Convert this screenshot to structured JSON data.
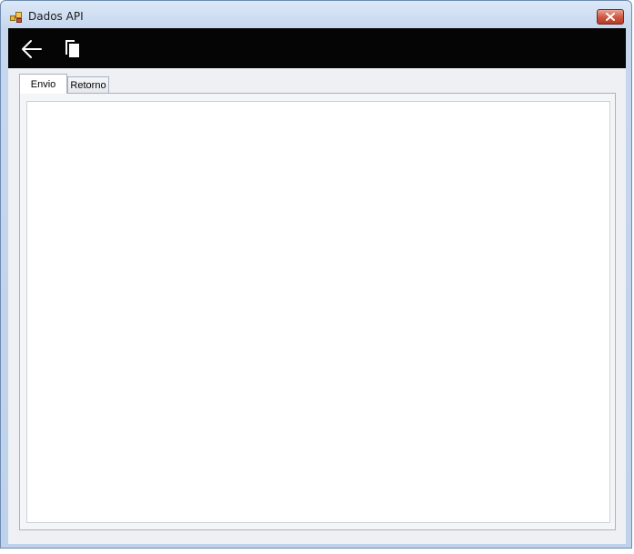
{
  "window": {
    "title": "Dados API",
    "icon": "app-window-icon",
    "close_icon": "close-icon"
  },
  "toolbar": {
    "back_icon": "back-arrow-icon",
    "copy_icon": "copy-icon"
  },
  "tabs": [
    {
      "label": "Envio",
      "selected": true
    },
    {
      "label": "Retorno",
      "selected": false
    }
  ],
  "content": {
    "text": ""
  }
}
